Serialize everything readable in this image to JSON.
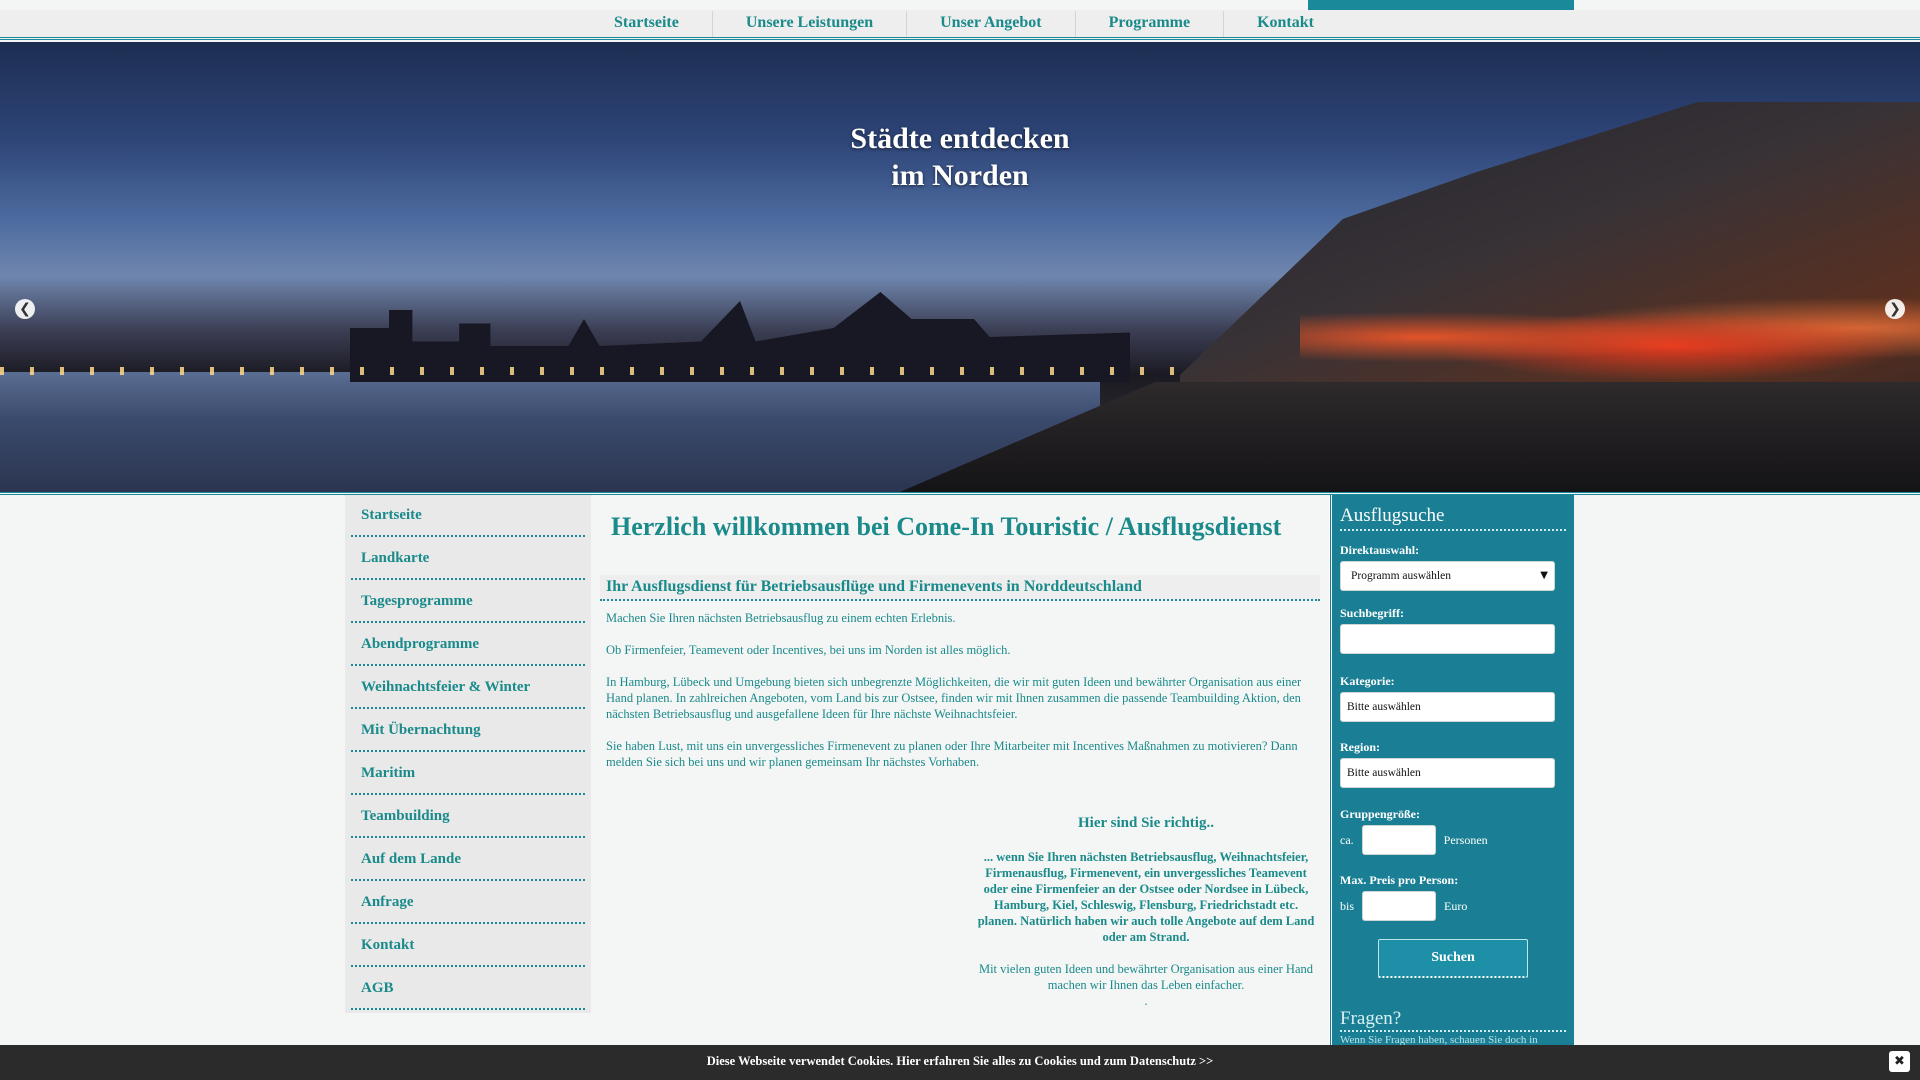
{
  "topnav": {
    "items": [
      "Startseite",
      "Unsere Leistungen",
      "Unser Angebot",
      "Programme",
      "Kontakt"
    ]
  },
  "hero": {
    "title_line1": "Städte entdecken",
    "title_line2": "im Norden",
    "prev_icon": "❮",
    "next_icon": "❯",
    "slide_count": 5,
    "active_slide": 1
  },
  "sidebar": {
    "items": [
      "Startseite",
      "Landkarte",
      "Tagesprogramme",
      "Abendprogramme",
      "Weihnachtsfeier & Winter",
      "Mit Übernachtung",
      "Maritim",
      "Teambuilding",
      "Auf dem Lande",
      "Anfrage",
      "Kontakt",
      "AGB"
    ]
  },
  "main": {
    "welcome": "Herzlich willkommen bei Come-In Touristic / Ausflugsdienst",
    "subhead": "Ihr Ausflugsdienst für Betriebsausflüge und Firmenevents in Norddeutschland",
    "paragraphs": [
      "Machen Sie Ihren nächsten Betriebsausflug zu einem echten Erlebnis.",
      "Ob Firmenfeier, Teamevent oder Incentives, bei uns im Norden ist alles möglich.",
      "In Hamburg, Lübeck und Umgebung bieten sich unbegrenzte Möglichkeiten, die wir mit guten Ideen und bewährter Organisation aus einer Hand planen. In zahlreichen Angeboten, vom Land bis zur Ostsee, finden wir mit Ihnen zusammen die passende Teambuilding Aktion, den nächsten Betriebsausflug und ausgefallene Ideen für Ihre nächste Weihnachtsfeier.",
      "Sie haben Lust, mit uns ein unvergessliches Firmenevent zu planen oder Ihre Mitarbeiter mit Incentives Maßnahmen zu motivieren? Dann melden Sie sich bei uns und wir planen gemeinsam Ihr nächstes Vorhaben."
    ],
    "richtig_title": "Hier sind Sie richtig..",
    "richtig_bold": "... wenn Sie Ihren nächsten Betriebsausflug, Weihnachtsfeier, Firmenausflug, Firmenevent, ein unvergessliches Teamevent oder eine Firmenfeier an der Ostsee oder Nordsee in Lübeck, Hamburg, Kiel, Schleswig, Flensburg, Friedrichstadt etc. planen. Natürlich haben wir auch tolle Angebote auf dem Land oder am Strand.",
    "richtig_text": "Mit vielen guten Ideen und bewährter Organisation aus einer Hand machen wir Ihnen das Leben einfacher.",
    "richtig_dot": "."
  },
  "search": {
    "title": "Ausflugsuche",
    "direkt_label": "Direktauswahl:",
    "direkt_value": "Programm auswählen",
    "suchbegriff_label": "Suchbegriff:",
    "suchbegriff_value": "",
    "kategorie_label": "Kategorie:",
    "kategorie_value": "Bitte auswählen",
    "region_label": "Region:",
    "region_value": "Bitte auswählen",
    "gruppe_label": "Gruppengröße:",
    "gruppe_prefix": "ca.",
    "gruppe_unit": "Personen",
    "preis_label": "Max. Preis pro Person:",
    "preis_prefix": "bis",
    "preis_unit": "Euro",
    "button": "Suchen",
    "fragen_title": "Fragen?",
    "fragen_text": "Wenn Sie Fragen haben, schauen Sie doch in"
  },
  "cookie": {
    "text": "Diese Webseite verwendet Cookies. Hier erfahren Sie alles zu Cookies und zum Datenschutz >>",
    "close_icon": "✖"
  }
}
